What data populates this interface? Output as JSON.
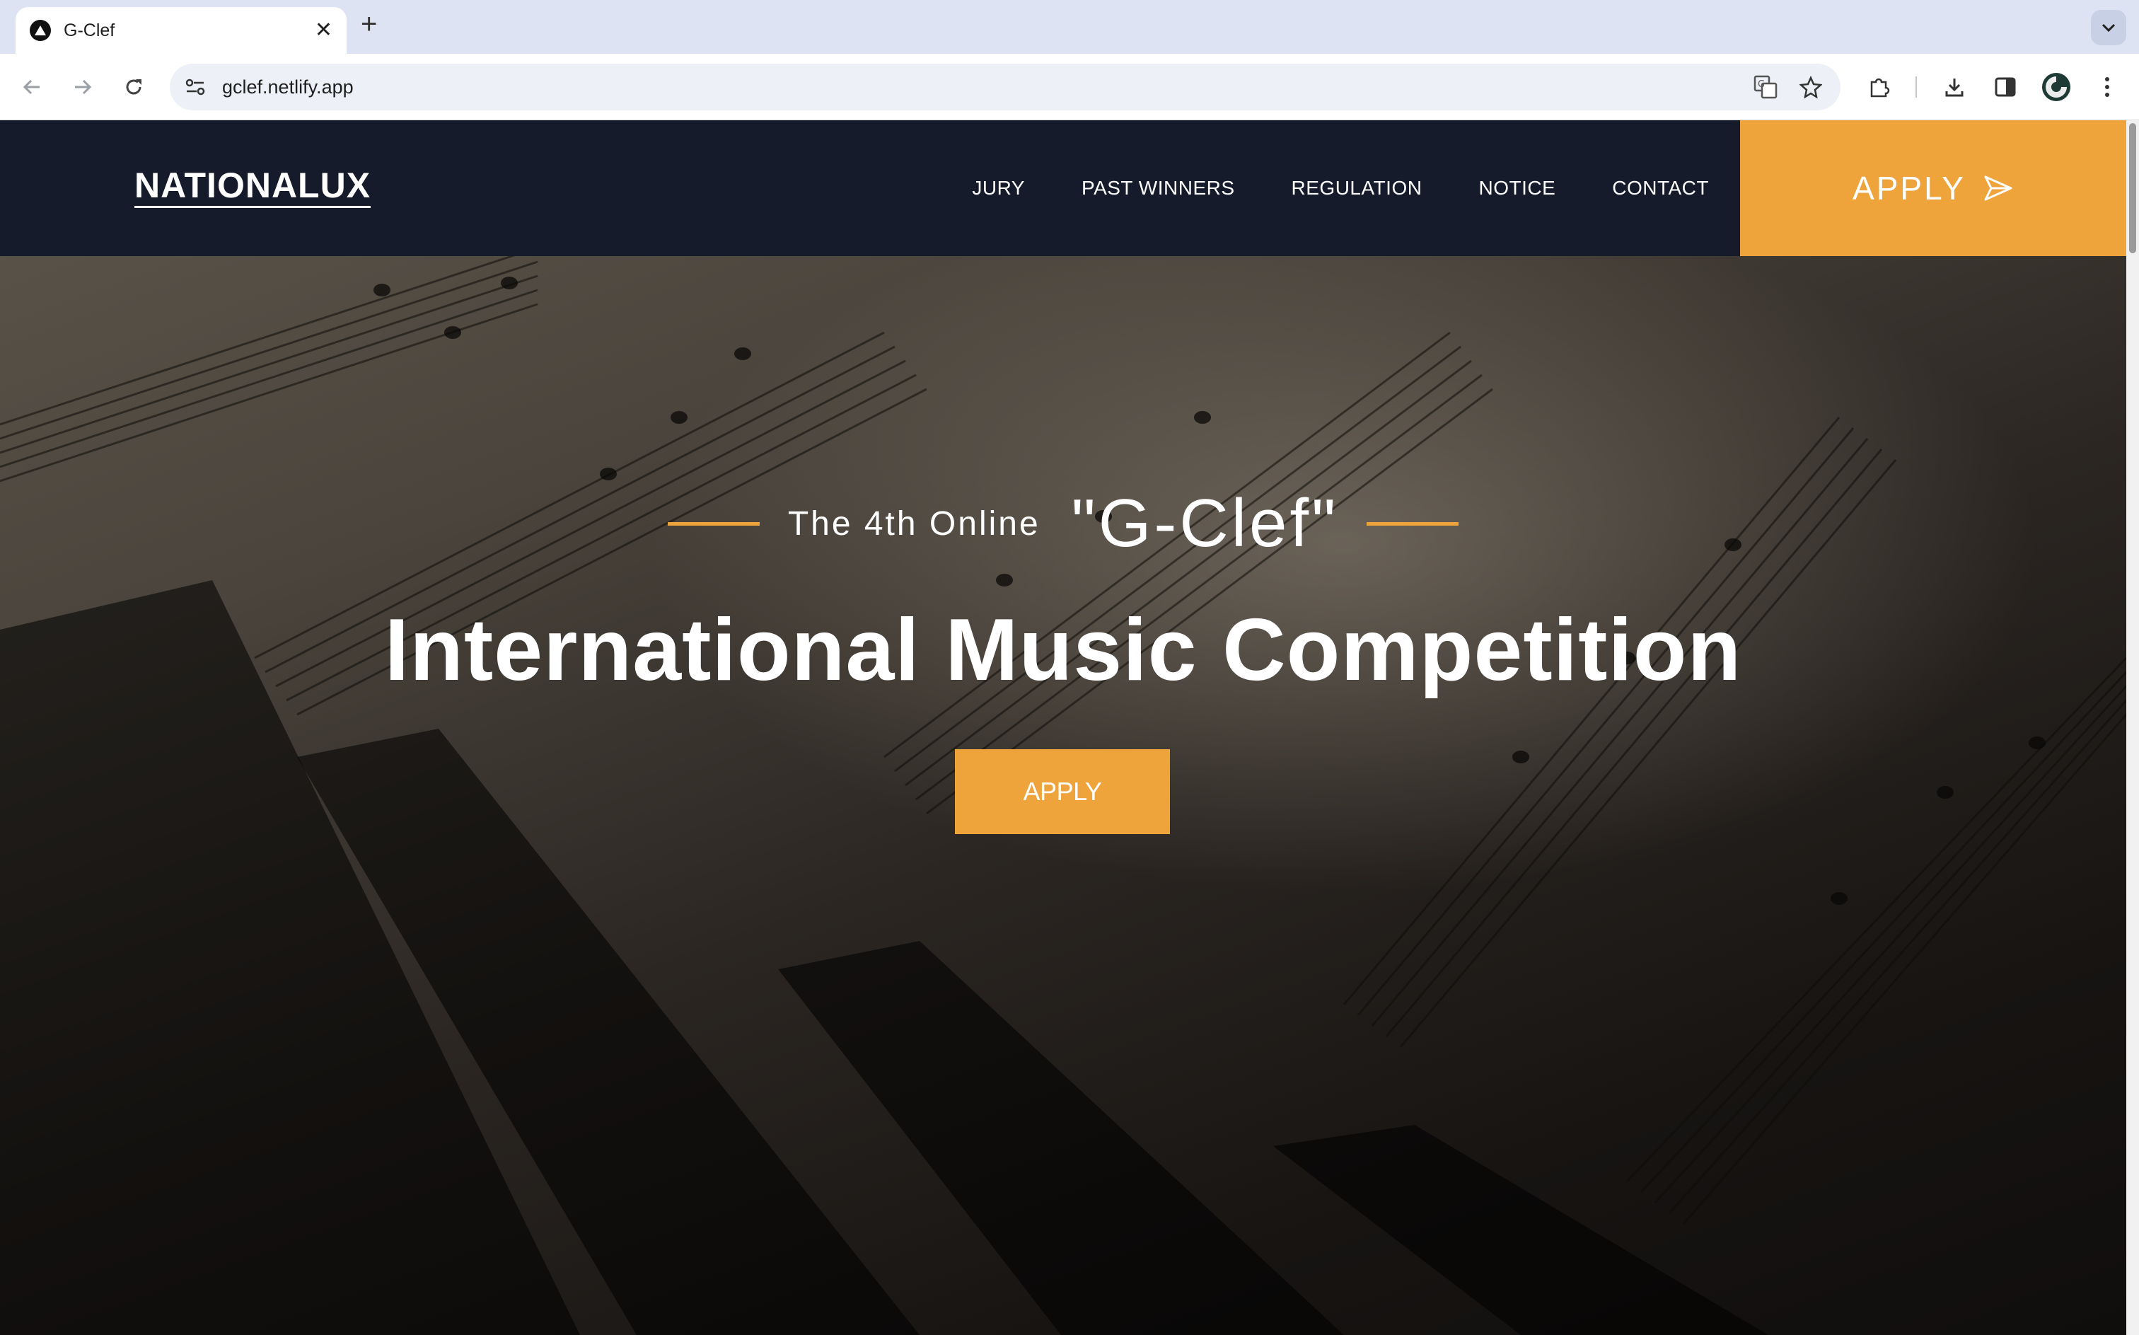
{
  "browser": {
    "tab": {
      "title": "G-Clef",
      "favicon": "triangle-logo-icon"
    },
    "url": "gclef.netlify.app"
  },
  "site": {
    "logo": "NATIONALUX",
    "nav": [
      {
        "label": "JURY"
      },
      {
        "label": "PAST WINNERS"
      },
      {
        "label": "REGULATION"
      },
      {
        "label": "NOTICE"
      },
      {
        "label": "CONTACT"
      }
    ],
    "header_apply": "APPLY",
    "accent_color": "#eea43b",
    "header_color": "#151b2b"
  },
  "hero": {
    "subtitle_small": "The 4th Online",
    "subtitle_big": "\"G-Clef\"",
    "title": "International Music Competition",
    "apply_label": "APPLY"
  }
}
